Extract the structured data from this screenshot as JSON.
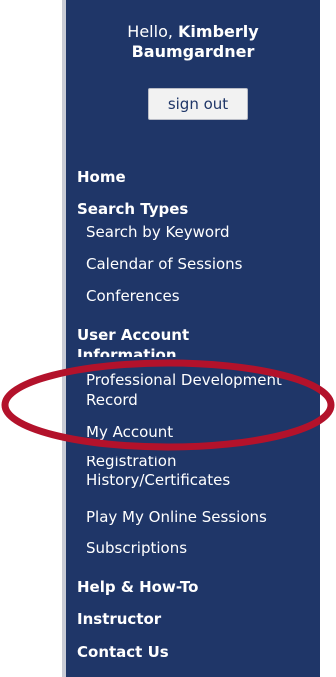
{
  "user": {
    "greeting_prefix": "Hello,",
    "name_line1": "Kimberly",
    "name_line2": "Baumgardner",
    "signout_label": "sign out"
  },
  "nav": {
    "home": "Home",
    "search_types": "Search Types",
    "search_by_keyword": "Search by Keyword",
    "calendar_of_sessions": "Calendar of Sessions",
    "conferences": "Conferences",
    "user_account_line1": "User Account",
    "user_account_line2": "Information",
    "pd_record_line1": "Professional Development",
    "pd_record_line2": "Record",
    "my_account": "My Account",
    "reg_history_line1": "Registration",
    "reg_history_line2": "History/Certificates",
    "play_online_sessions": "Play My Online Sessions",
    "subscriptions": "Subscriptions",
    "help_how_to": "Help & How-To",
    "instructor": "Instructor",
    "contact_us": "Contact Us"
  },
  "colors": {
    "sidebar_bg": "#1f3668",
    "highlight_ellipse": "#b3122b",
    "text": "#ffffff"
  }
}
